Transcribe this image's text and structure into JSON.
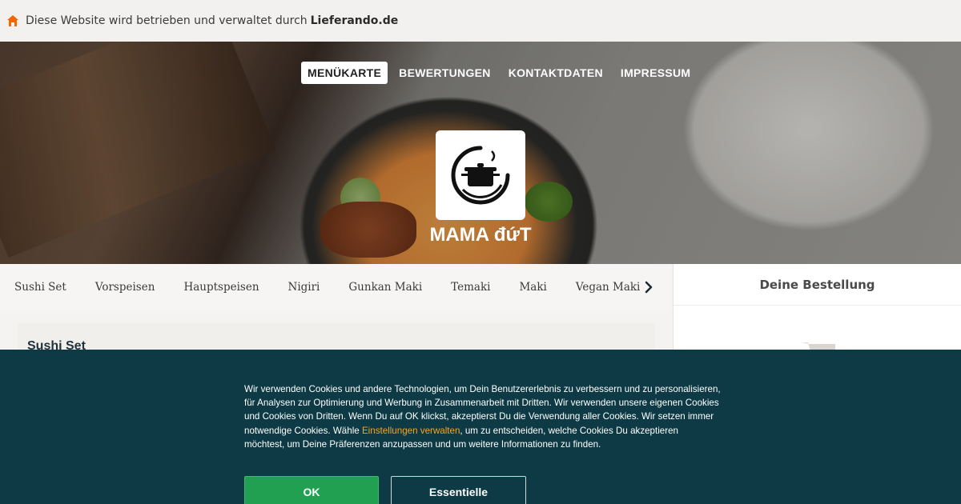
{
  "topbar": {
    "text": "Diese Website wird betrieben und verwaltet durch",
    "brand": "Lieferando.de",
    "icon": "house-icon",
    "icon_color": "#f36805"
  },
  "nav": {
    "items": [
      "MENÜKARTE",
      "BEWERTUNGEN",
      "KONTAKTDATEN",
      "IMPRESSUM"
    ],
    "active": "MENÜKARTE"
  },
  "restaurant": {
    "name": "MAMA đứT",
    "logo_icon": "cooking-pot-icon"
  },
  "categories": {
    "items": [
      "Sushi Set",
      "Vorspeisen",
      "Hauptspeisen",
      "Nigiri",
      "Gunkan Maki",
      "Temaki",
      "Maki",
      "Vegan Maki"
    ],
    "next_icon": "chevron-right-icon"
  },
  "basket": {
    "title": "Deine Bestellung",
    "icon": "shopping-cart-icon"
  },
  "content": {
    "section_title": "Sushi Set"
  },
  "cookie": {
    "text_before": "Wir verwenden Cookies und andere Technologien, um Dein Benutzererlebnis zu verbessern und zu personalisieren, für Analysen zur Optimierung und Werbung in Zusammenarbeit mit Dritten. Wir verwenden unsere eigenen Cookies und Cookies von Dritten. Wenn Du auf OK klickst, akzeptierst Du die Verwendung aller Cookies. Wir setzen immer notwendige Cookies. Wähle ",
    "link": "Einstellungen verwalten",
    "text_after": ", um zu entscheiden, welche Cookies Du akzeptieren möchtest, um Deine Präferenzen anzupassen und um weitere Informationen zu finden.",
    "ok_label": "OK",
    "essential_label": "Essentielle",
    "colors": {
      "background": "#0d3a45",
      "ok": "#22a052",
      "link": "#f5a623"
    }
  }
}
